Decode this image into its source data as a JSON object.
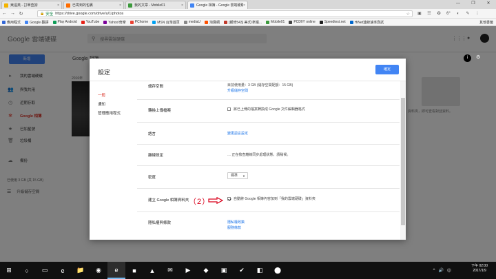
{
  "browser": {
    "tabs": [
      {
        "title": "東遠英 - 訂單查詢",
        "color": "#f4b400"
      },
      {
        "title": "已寄到的包裹",
        "color": "#ff6d00"
      },
      {
        "title": "我的文章 - Mobile01",
        "color": "#3c9a3c"
      },
      {
        "title": "Google 相簿 - Google 雲端硬碟",
        "color": "#4285f4"
      }
    ],
    "tab_close": "×",
    "window_controls": [
      "—",
      "❐",
      "✕"
    ],
    "nav": {
      "back": "←",
      "forward": "→",
      "reload": "↻"
    },
    "security_label": "安全",
    "url": "https://drive.google.com/drive/u/1/photos",
    "ext_badge": "6°",
    "bookmarks": [
      {
        "label": "應用程式",
        "color": "#3367d6"
      },
      {
        "label": "Google 翻譯",
        "color": "#4285f4"
      },
      {
        "label": "Play Android",
        "color": "#0f9d58"
      },
      {
        "label": "YouTube",
        "color": "#e62117"
      },
      {
        "label": "Yahoo!奇摩",
        "color": "#7b0099"
      },
      {
        "label": "PChome",
        "color": "#ea4335"
      },
      {
        "label": "MSN 台灣首頁",
        "color": "#00a1f1"
      },
      {
        "label": "mediaU",
        "color": "#888888"
      },
      {
        "label": "淘寶網",
        "color": "#ff5000"
      },
      {
        "label": "[報修543] 美式/拿鐵...",
        "color": "#c0392b"
      },
      {
        "label": "Mobile01",
        "color": "#3c9a3c"
      },
      {
        "label": "PCDIY! online",
        "color": "#444444"
      },
      {
        "label": "Speedtest.net",
        "color": "#1d1d1d"
      },
      {
        "label": "HiNet連線速率測試",
        "color": "#0066cc"
      }
    ],
    "bookmarks_more": "其他書籤"
  },
  "drive": {
    "logo_google": "Google",
    "logo_product": "雲端硬碟",
    "search_placeholder": "搜尋雲端硬碟",
    "new_button": "新增",
    "section_title": "Google 相簿",
    "sidebar": [
      {
        "label": "我的雲端硬碟",
        "icon": "folder-icon"
      },
      {
        "label": "與我共用",
        "icon": "people-icon"
      },
      {
        "label": "近期存取",
        "icon": "clock-icon"
      },
      {
        "label": "Google 相簿",
        "icon": "pinwheel-icon"
      },
      {
        "label": "已加星號",
        "icon": "star-icon"
      },
      {
        "label": "垃圾桶",
        "icon": "trash-icon"
      }
    ],
    "backup_label": "備份",
    "storage_text": "已使用 3 GB (共 15 GB)",
    "upgrade_label": "升級儲存空間",
    "bg_date": "2016年",
    "bg_empty_text": "資料夾，即可查看對話資料。"
  },
  "dialog": {
    "title": "設定",
    "done_button": "確定",
    "nav": [
      "一般",
      "通知",
      "管理應用程式"
    ],
    "rows": [
      {
        "label": "儲存空間",
        "value": "目前使用量：3 GB (儲存空間配額：15 GB)",
        "link": "升級儲存空間"
      },
      {
        "label": "轉換上傳檔案",
        "checkbox_text": "將已上傳的檔案轉換成 Google 文件編輯器格式",
        "checked": false
      },
      {
        "label": "語言",
        "link": "變更語言設定"
      },
      {
        "label": "離線設定",
        "value": "…  正在檢查離線同步處理狀態，請稍候。"
      },
      {
        "label": "密度",
        "select_value": "標準"
      },
      {
        "label": "建立 Google 相簿資料夾",
        "checkbox_text": "自動將 Google 相簿內容加到「我的雲端硬碟」資料夾",
        "checked": true
      },
      {
        "label": "隱私權與條款",
        "link": "隱私權政策",
        "link2": "服務條款"
      }
    ]
  },
  "annotation": {
    "text": "（2）",
    "color": "#d9001b"
  },
  "taskbar": {
    "apps": [
      "⊞",
      "○",
      "▭",
      "e",
      "📁",
      "◉",
      "e",
      "■",
      "▲",
      "✉",
      "▶",
      "◆",
      "▣",
      "✔",
      "◧",
      "⬤"
    ],
    "tray": [
      "^",
      "🔊",
      "中"
    ],
    "time": "下午 02:00",
    "date": "2017/1/9"
  }
}
